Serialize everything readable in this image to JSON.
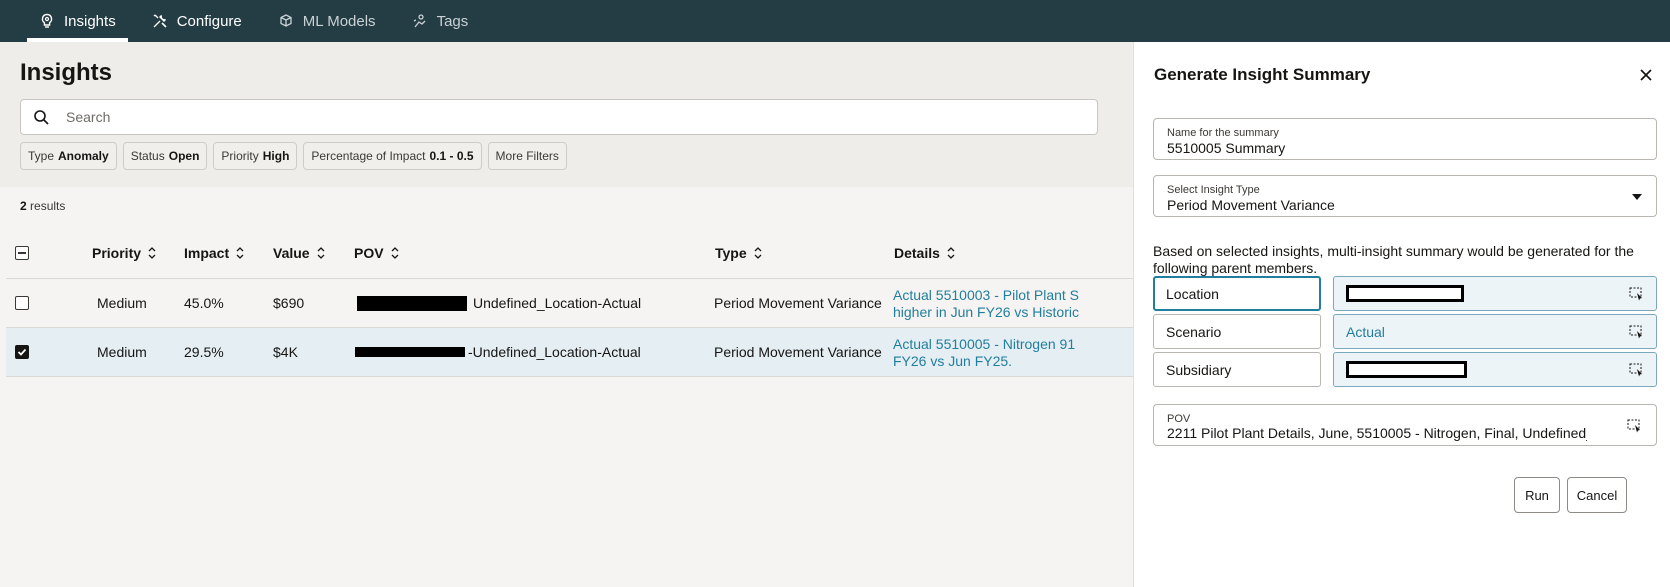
{
  "nav": {
    "tabs": [
      {
        "label": "Insights",
        "icon": "lightbulb-icon",
        "active": true
      },
      {
        "label": "Configure",
        "icon": "tools-icon",
        "active": false
      },
      {
        "label": "ML Models",
        "icon": "cubes-icon",
        "active": false
      },
      {
        "label": "Tags",
        "icon": "tag-person-icon",
        "active": false
      }
    ]
  },
  "page": {
    "title": "Insights",
    "search_placeholder": "Search",
    "filters": [
      {
        "label": "Type",
        "value": "Anomaly"
      },
      {
        "label": "Status",
        "value": "Open"
      },
      {
        "label": "Priority",
        "value": "High"
      },
      {
        "label": "Percentage of Impact",
        "value": "0.1 - 0.5"
      }
    ],
    "more_filters": "More Filters",
    "results_count": "2",
    "results_label": " results"
  },
  "table": {
    "columns": [
      "Priority",
      "Impact",
      "Value",
      "POV",
      "Type",
      "Details"
    ],
    "rows": [
      {
        "checked": false,
        "priority": "Medium",
        "impact": "45.0%",
        "value": "$690",
        "pov": "Undefined_Location-Actual",
        "type": "Period Movement Variance",
        "details_line1": "Actual 5510003 - Pilot Plant S",
        "details_line2": "higher in Jun FY26 vs Historic"
      },
      {
        "checked": true,
        "priority": "Medium",
        "impact": "29.5%",
        "value": "$4K",
        "pov": "-Undefined_Location-Actual",
        "type": "Period Movement Variance",
        "details_line1": "Actual 5510005 - Nitrogen 91",
        "details_line2": "FY26 vs Jun FY25."
      }
    ]
  },
  "drawer": {
    "title": "Generate Insight Summary",
    "name_label": "Name for the summary",
    "name_value": "5510005 Summary",
    "type_label": "Select Insight Type",
    "type_value": "Period Movement Variance",
    "hint": "Based on selected insights, multi-insight summary would be generated for the following parent members.",
    "members": [
      {
        "name": "Location",
        "value": "",
        "redacted": true,
        "focused": true
      },
      {
        "name": "Scenario",
        "value": "Actual",
        "redacted": false,
        "focused": false
      },
      {
        "name": "Subsidiary",
        "value": "",
        "redacted": true,
        "focused": false
      }
    ],
    "pov_label": "POV",
    "pov_value": "2211 Pilot Plant Details, June, 5510005 - Nitrogen, Final, Undefined_Related_Party",
    "run_label": "Run",
    "cancel_label": "Cancel"
  }
}
